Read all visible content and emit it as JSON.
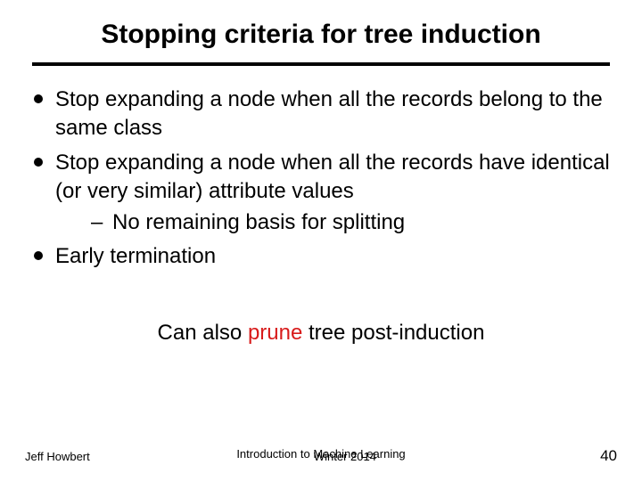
{
  "title": "Stopping criteria for tree induction",
  "bullets": [
    {
      "text": "Stop expanding a node when all the records belong to the same class",
      "sub": []
    },
    {
      "text": "Stop expanding a node when all the records have identical (or very similar) attribute values",
      "sub": [
        "No remaining basis for splitting"
      ]
    },
    {
      "text": "Early termination",
      "sub": []
    }
  ],
  "note": {
    "pre": "Can also ",
    "highlight": "prune",
    "post": " tree post-induction"
  },
  "footer": {
    "left": "Jeff Howbert",
    "center": "Introduction to Machine Learning",
    "right": "Winter 2014",
    "page": "40"
  }
}
